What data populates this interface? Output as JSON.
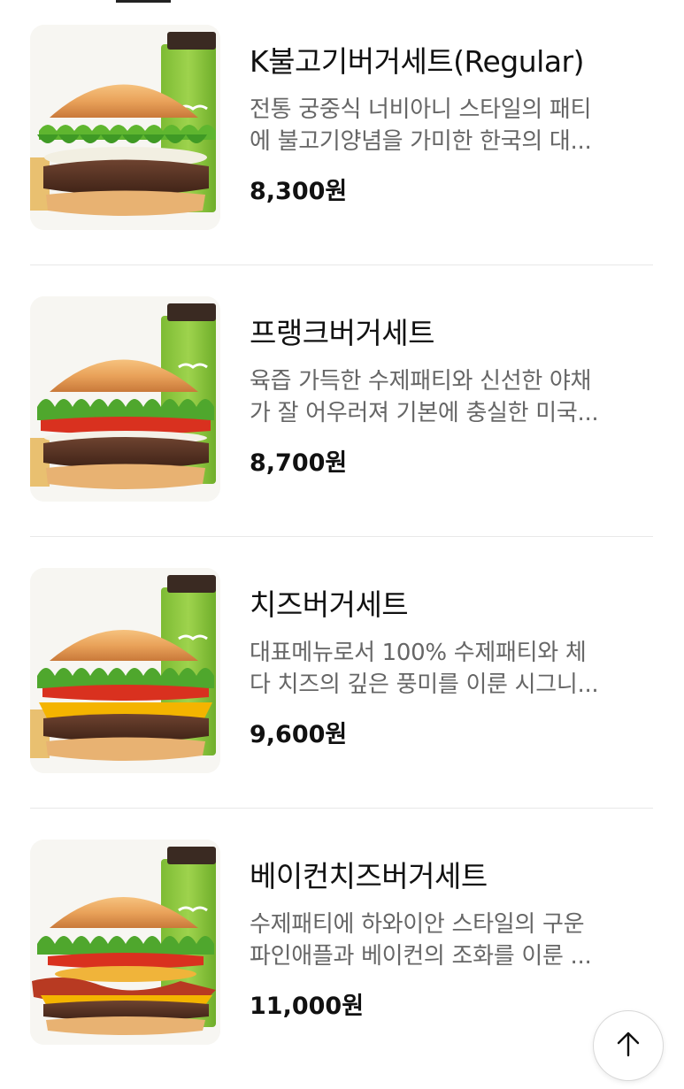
{
  "menu": {
    "items": [
      {
        "name": "K불고기버거세트(Regular)",
        "desc_line1": "전통 궁중식 너비아니 스타일의 패티",
        "desc_line2": "에 불고기양념을 가미한 한국의 대...",
        "price": "8,300원",
        "image": "k-bulgogi-burger-set-image"
      },
      {
        "name": "프랭크버거세트",
        "desc_line1": "육즙 가득한 수제패티와 신선한 야채",
        "desc_line2": "가 잘 어우러져 기본에 충실한 미국...",
        "price": "8,700원",
        "image": "frank-burger-set-image"
      },
      {
        "name": "치즈버거세트",
        "desc_line1": "대표메뉴로서 100% 수제패티와 체",
        "desc_line2": "다 치즈의 깊은 풍미를 이룬 시그니...",
        "price": "9,600원",
        "image": "cheese-burger-set-image"
      },
      {
        "name": "베이컨치즈버거세트",
        "desc_line1": "수제패티에 하와이안 스타일의 구운",
        "desc_line2": "파인애플과 베이컨의 조화를 이룬 ...",
        "price": "11,000원",
        "image": "bacon-cheese-burger-set-image"
      }
    ]
  },
  "scroll_top": {
    "icon": "arrow-up-icon"
  },
  "colors": {
    "drink_cup": "#8cc63f",
    "bun": "#e9a25a",
    "lettuce": "#4fa72d",
    "patty": "#5a3423",
    "cheese": "#f4b400",
    "tomato": "#d9311f"
  }
}
